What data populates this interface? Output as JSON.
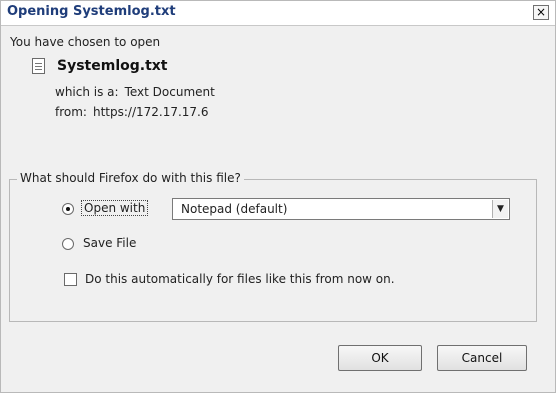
{
  "window": {
    "title": "Opening Systemlog.txt",
    "close_glyph": "×"
  },
  "body": {
    "chosen_text": "You have chosen to open",
    "file_name": "Systemlog.txt",
    "which_is_label": "which is a:",
    "which_is_value": "Text Document",
    "from_label": "from:",
    "from_value": "https://172.17.17.6"
  },
  "action_group": {
    "label": "What should Firefox do with this file?",
    "open_with_label": "Open with",
    "open_with_selected": true,
    "app_select_value": "Notepad (default)",
    "save_file_label": "Save File",
    "save_file_selected": false,
    "auto_label": "Do this automatically for files like this from now on.",
    "auto_checked": false
  },
  "buttons": {
    "ok": "OK",
    "cancel": "Cancel"
  },
  "icons": {
    "file": "document-icon",
    "close": "close-icon",
    "dropdown": "chevron-down-icon"
  }
}
